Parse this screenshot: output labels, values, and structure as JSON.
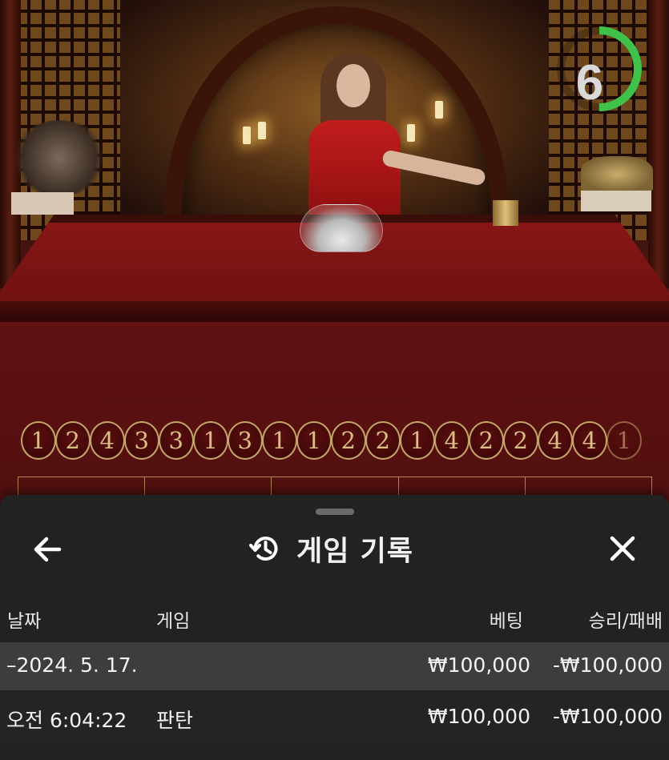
{
  "timer": {
    "value": "6",
    "remaining_fraction": 0.5
  },
  "results_road": [
    "1",
    "2",
    "4",
    "3",
    "3",
    "1",
    "3",
    "1",
    "1",
    "2",
    "2",
    "1",
    "4",
    "2",
    "2",
    "4",
    "4",
    "1"
  ],
  "panel": {
    "title": "게임 기록",
    "columns": {
      "date": "날짜",
      "game": "게임",
      "bet": "베팅",
      "winloss": "승리/패배"
    },
    "date_row": {
      "date": "–2024. 5. 17.",
      "bet": "₩100,000",
      "winloss": "-₩100,000"
    },
    "entries": [
      {
        "time": "오전 6:04:22",
        "game": "판탄",
        "bet": "₩100,000",
        "winloss": "-₩100,000"
      }
    ]
  },
  "colors": {
    "accent_green": "#3fc14a",
    "felt_red": "#7a1414",
    "gold": "#c3a468",
    "panel_bg": "#222222"
  },
  "icons": {
    "back": "arrow-left-icon",
    "history": "history-clock-icon",
    "close": "close-icon"
  }
}
